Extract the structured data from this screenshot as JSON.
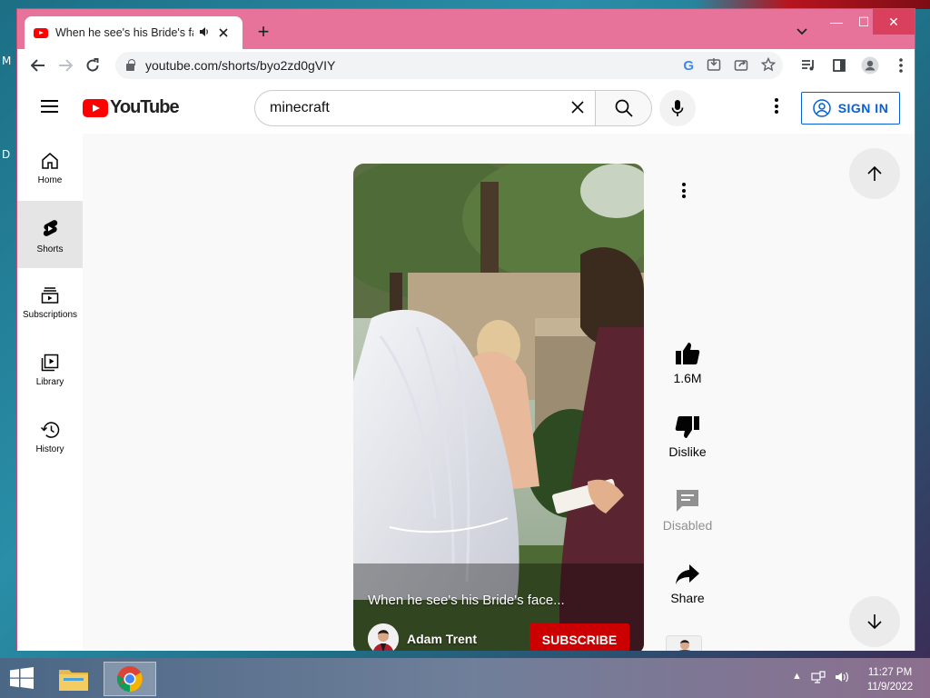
{
  "desktop": {
    "letter_top": "M",
    "letter_mid": "D"
  },
  "browser": {
    "tab": {
      "title": "When he see's his Bride's fac",
      "audio_icon": "speaker-icon",
      "close_icon": "close-icon"
    },
    "new_tab_icon": "+",
    "tab_search_icon": "⌄",
    "window_controls": {
      "minimize": "—",
      "maximize": "☐",
      "close": "✕"
    },
    "toolbar": {
      "back": "←",
      "forward": "→",
      "reload": "↻",
      "url": "youtube.com/shorts/byo2zd0gVIY"
    }
  },
  "youtube": {
    "logo_text": "YouTube",
    "search": {
      "value": "minecraft",
      "clear_icon": "✕"
    },
    "signin_label": "SIGN IN",
    "sidebar": [
      {
        "label": "Home",
        "icon": "home-icon",
        "active": false
      },
      {
        "label": "Shorts",
        "icon": "shorts-icon",
        "active": true
      },
      {
        "label": "Subscriptions",
        "icon": "subscriptions-icon",
        "active": false
      },
      {
        "label": "Library",
        "icon": "library-icon",
        "active": false
      },
      {
        "label": "History",
        "icon": "history-icon",
        "active": false
      }
    ],
    "short": {
      "title": "When he see's his Bride's face...",
      "channel": "Adam Trent",
      "subscribe_label": "SUBSCRIBE"
    },
    "actions": {
      "like_count": "1.6M",
      "dislike_label": "Dislike",
      "comments_label": "Disabled",
      "share_label": "Share"
    }
  },
  "taskbar": {
    "time": "11:27 PM",
    "date": "11/9/2022"
  }
}
